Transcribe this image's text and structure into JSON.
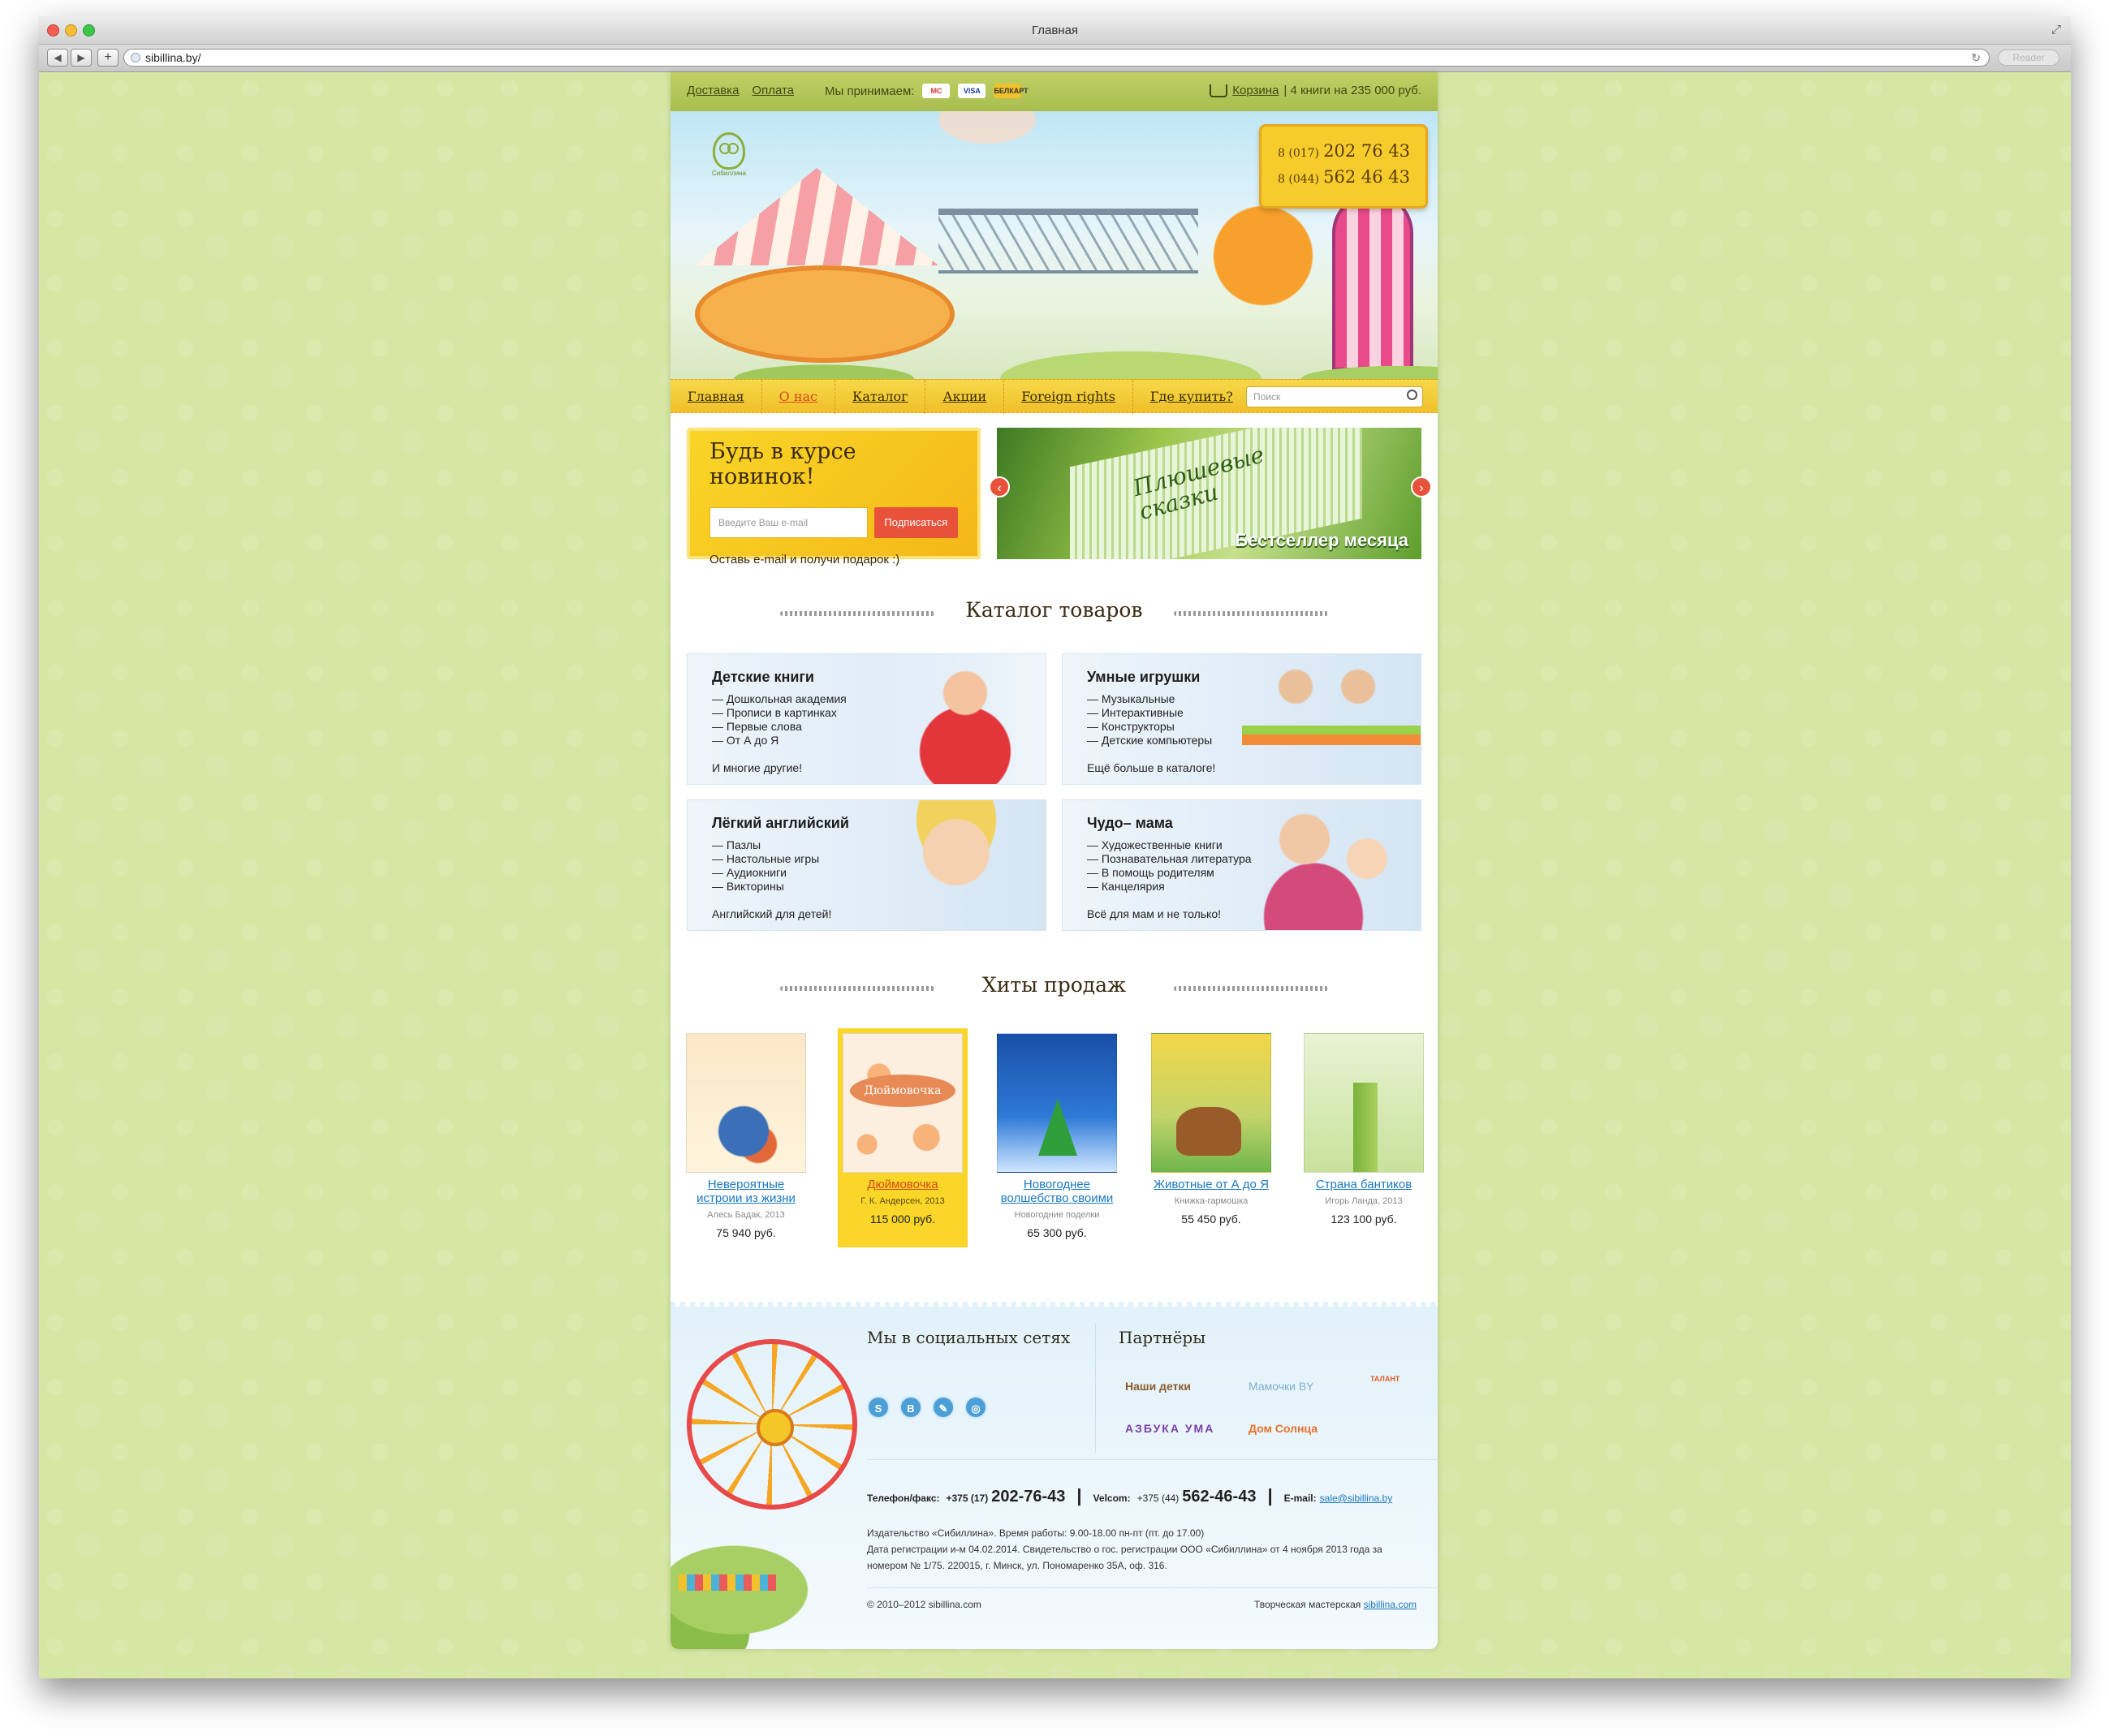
{
  "browser": {
    "window_title": "Главная",
    "url": "sibillina.by/",
    "reader_label": "Reader"
  },
  "topbar": {
    "links": [
      "Доставка",
      "Оплата"
    ],
    "accept_label": "Мы принимаем:",
    "cards": [
      "MC",
      "VISA",
      "БЕЛКАРТ"
    ],
    "cart_link": "Корзина",
    "cart_summary": "| 4 книги на 235 000 руб."
  },
  "logo": {
    "name": "Сибиллина"
  },
  "phones": [
    {
      "prefix": "8 (017)",
      "number": "202 76 43"
    },
    {
      "prefix": "8 (044)",
      "number": "562 46 43"
    }
  ],
  "menu": {
    "items": [
      "Главная",
      "О нас",
      "Каталог",
      "Акции",
      "Foreign rights",
      "Где купить?"
    ],
    "active": "О нас",
    "search_placeholder": "Поиск"
  },
  "subscribe": {
    "title": "Будь в курсе новинок!",
    "email_placeholder": "Введите Ваш e-mail",
    "button": "Подписаться",
    "note": "Оставь e-mail и получи подарок :)"
  },
  "banner": {
    "book_title": "Плюшевые сказки",
    "caption": "Бестселлер месяца"
  },
  "catalog": {
    "heading": "Каталог товаров",
    "categories": [
      {
        "title": "Детские книги",
        "items": [
          "Дошкольная академия",
          "Прописи в картинках",
          "Первые слова",
          "От А до Я"
        ],
        "more": "И многие другие!"
      },
      {
        "title": "Умные игрушки",
        "items": [
          "Музыкальные",
          "Интерактивные",
          "Конструкторы",
          "Детские компьютеры"
        ],
        "more": "Ещё больше в каталоге!"
      },
      {
        "title": "Лёгкий английский",
        "items": [
          "Пазлы",
          "Настольные игры",
          "Аудиокниги",
          "Викторины"
        ],
        "more": "Английский для детей!"
      },
      {
        "title": "Чудо– мама",
        "items": [
          "Художественные книги",
          "Познавательная литература",
          "В помощь родителям",
          "Канцелярия"
        ],
        "more": "Всё для мам и не только!"
      }
    ]
  },
  "hits": {
    "heading": "Хиты продаж",
    "books": [
      {
        "title": "Невероятные истроии из жизни",
        "meta": "Алесь Бадак, 2013",
        "price": "75 940 руб.",
        "selected": false
      },
      {
        "title": "Дюймовочка",
        "meta": "Г. К. Андерсен, 2013",
        "price": "115 000 руб.",
        "selected": true
      },
      {
        "title": "Новогоднее волшебство своими",
        "meta": "Новогодние поделки",
        "price": "65 300 руб.",
        "selected": false
      },
      {
        "title": "Животные от А до Я",
        "meta": "Книжка-гармошка",
        "price": "55 450 руб.",
        "selected": false
      },
      {
        "title": "Страна бантиков",
        "meta": "Игорь Ланда, 2013",
        "price": "123 100 руб.",
        "selected": false
      }
    ]
  },
  "footer": {
    "social_heading": "Мы в социальных сетях",
    "social": [
      "S",
      "B",
      "✎",
      "◎"
    ],
    "partners_heading": "Партнёры",
    "partners": [
      "Наши детки",
      "Мамочки BY",
      "ТАЛАНТ",
      "АЗБУКА УМА",
      "Дом Солнца"
    ],
    "phone_label": "Телефон/факс:",
    "phone_prefix": "+375 (17)",
    "phone": "202-76-43",
    "velcom_label": "Velcom:",
    "velcom_prefix": "+375 (44)",
    "velcom": "562-46-43",
    "email_label": "E-mail:",
    "email": "sale@sibillina.by",
    "legal_1": "Издательство «Сибиллина». Время работы: 9.00-18.00 пн-пт (пт. до 17.00)",
    "legal_2": "Дата регистрации и-м 04.02.2014. Свидетельство о гос. регистрации ООО «Сибиллина» от 4 ноября 2013 года за номером № 1/75.  220015, г. Минск, ул. Пономаренко 35А, оф. 316.",
    "copyright": "© 2010–2012 sibillina.com",
    "studio_label": "Творческая мастерская",
    "studio_link": "sibillina.com"
  }
}
